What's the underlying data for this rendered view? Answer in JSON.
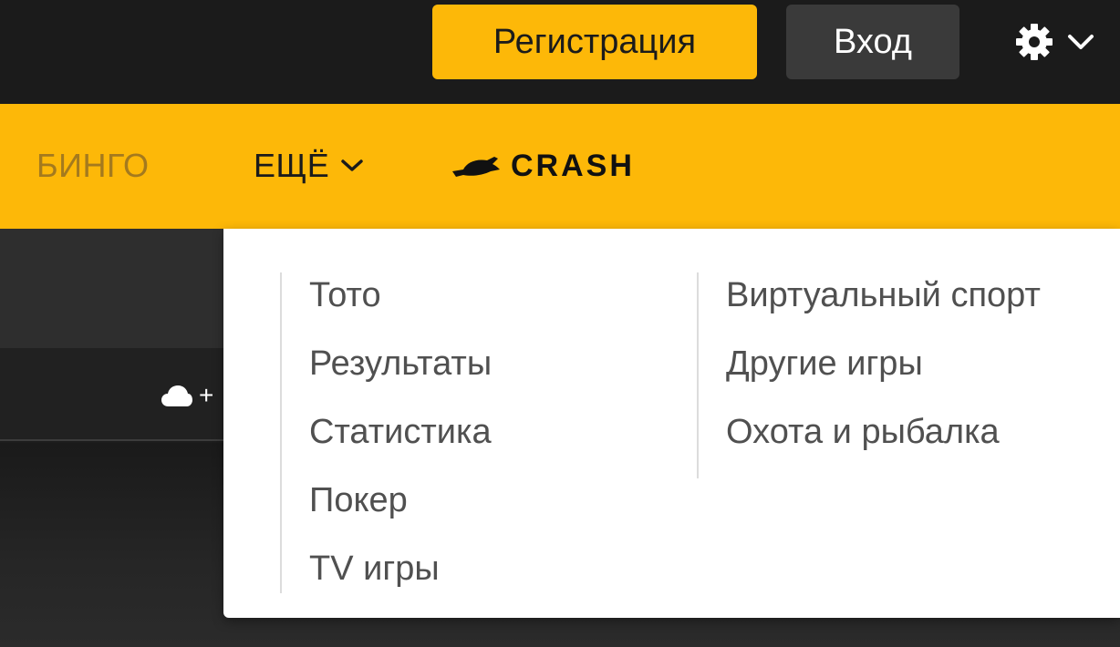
{
  "header": {
    "register_label": "Регистрация",
    "login_label": "Вход",
    "settings_icon": "gear-icon",
    "settings_chevron": "chevron-down-icon"
  },
  "nav": {
    "items": [
      {
        "label": "БИНГО"
      },
      {
        "label": "ЕЩЁ",
        "icon": "chevron-down-icon"
      },
      {
        "label": "CRASH",
        "icon": "crash-plane-icon"
      }
    ]
  },
  "dropdown": {
    "left_column": [
      {
        "label": "Тото"
      },
      {
        "label": "Результаты"
      },
      {
        "label": "Статистика"
      },
      {
        "label": "Покер"
      },
      {
        "label": "TV игры"
      }
    ],
    "right_column": [
      {
        "label": "Виртуальный спорт"
      },
      {
        "label": "Другие игры"
      },
      {
        "label": "Охота и рыбалка"
      }
    ]
  },
  "background": {
    "cloud_icon": "cloud-icon",
    "cloud_suffix": "+"
  },
  "colors": {
    "accent": "#fdb808",
    "topbar": "#1b1b1b",
    "login_button": "#3a3a3a",
    "menu_text": "#505050",
    "inactive_nav": "#a47a1e"
  }
}
